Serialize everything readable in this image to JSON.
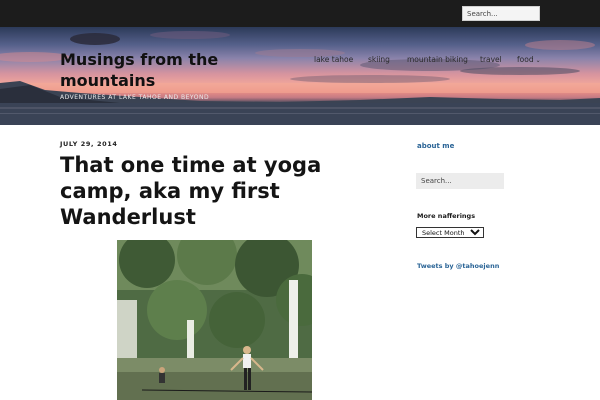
{
  "topbar": {
    "search_placeholder": "Search..."
  },
  "header": {
    "site_title": "Musings from the mountains",
    "tagline": "Adventures at Lake Tahoe and beyond"
  },
  "nav": {
    "items": [
      {
        "label": "lake tahoe",
        "has_dropdown": false
      },
      {
        "label": "skiing",
        "has_dropdown": false
      },
      {
        "label": "mountain biking",
        "has_dropdown": false
      },
      {
        "label": "travel",
        "has_dropdown": false
      },
      {
        "label": "food",
        "has_dropdown": true
      }
    ],
    "dropdown_glyph": "⌄"
  },
  "post": {
    "date": "July 29, 2014",
    "title": "That one time at yoga camp, aka my first Wanderlust"
  },
  "sidebar": {
    "about_link": "about me",
    "search_placeholder": "Search...",
    "archives_title": "More nafferings",
    "archive_select_value": "Select Month",
    "tweets_link": "Tweets by @tahoejenn"
  },
  "colors": {
    "topbar": "#1c1c1c",
    "link_blue": "#2a6496",
    "sky_pink": "#f0a59b",
    "lake_dark": "#323b4e"
  }
}
